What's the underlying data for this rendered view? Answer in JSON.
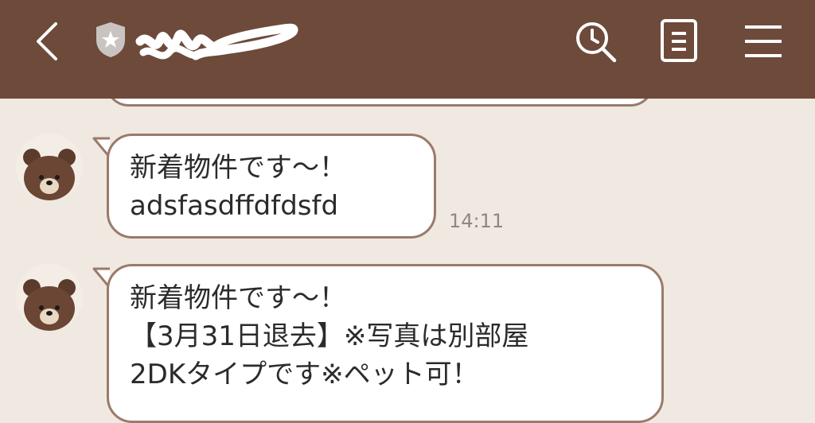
{
  "header": {
    "back_icon": "chevron-left-icon",
    "official_badge_icon": "shield-star-icon",
    "title_redacted": true,
    "actions": [
      {
        "name": "search-history",
        "icon": "clock-search-icon"
      },
      {
        "name": "notes",
        "icon": "note-icon"
      },
      {
        "name": "menu",
        "icon": "hamburger-menu-icon"
      }
    ],
    "colors": {
      "header_bg": "#6e4a3b",
      "icon": "#ffffff"
    }
  },
  "messages": [
    {
      "sender_avatar": "brown-bear-avatar",
      "text": "新着物件です～！\nadsfasdffdfdsfd",
      "time": "14:11"
    },
    {
      "sender_avatar": "brown-bear-avatar",
      "text": "新着物件です～！\n【3月31日退去】※写真は別部屋\n2DKタイプです※ペット可！",
      "time": ""
    }
  ],
  "colors": {
    "chat_bg": "#efe9e2",
    "bubble_border": "#9b7a6a",
    "bubble_bg": "#ffffff"
  }
}
